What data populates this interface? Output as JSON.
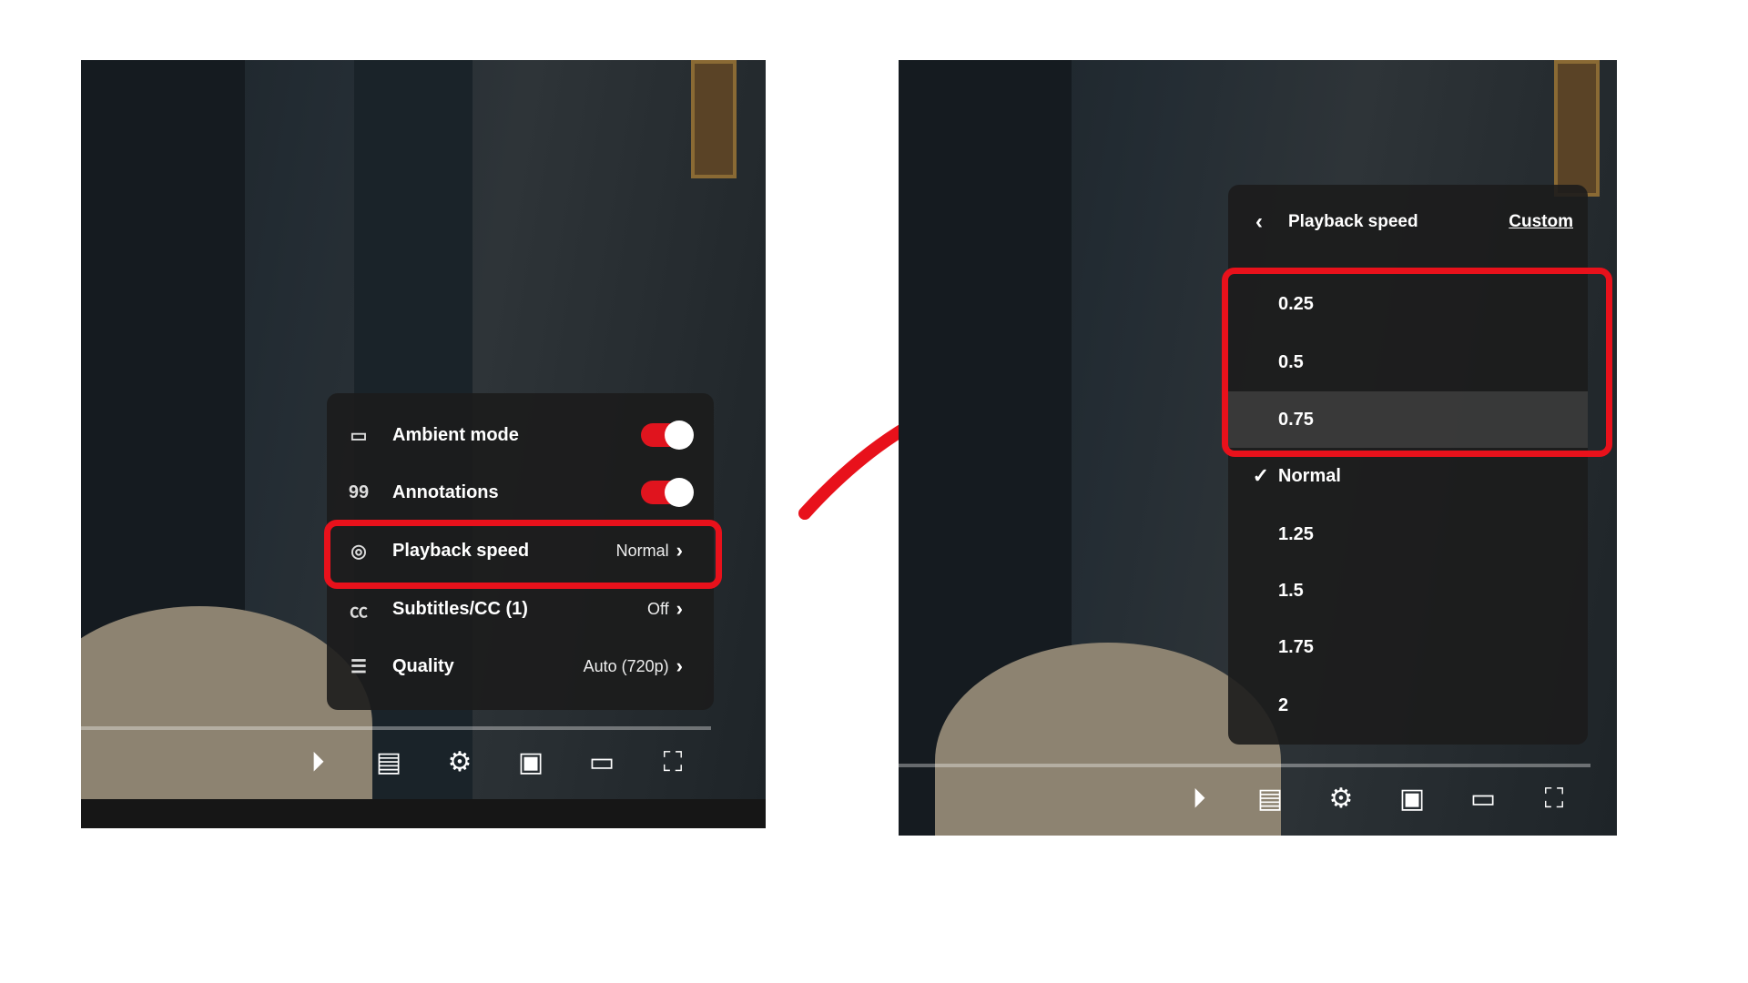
{
  "left_panel": {
    "menu": [
      {
        "icon": "ambient-mode-icon",
        "label": "Ambient mode",
        "toggle": true
      },
      {
        "icon": "annotations-icon",
        "label": "Annotations",
        "toggle": true
      },
      {
        "icon": "playback-speed-icon",
        "label": "Playback speed",
        "value": "Normal",
        "highlighted": true
      },
      {
        "icon": "subtitles-icon",
        "label": "Subtitles/CC (1)",
        "value": "Off"
      },
      {
        "icon": "quality-icon",
        "label": "Quality",
        "value": "Auto (720p)"
      }
    ]
  },
  "right_panel": {
    "header": {
      "title": "Playback speed",
      "custom": "Custom"
    },
    "options": [
      "0.25",
      "0.5",
      "0.75",
      "Normal",
      "1.25",
      "1.5",
      "1.75",
      "2"
    ],
    "selected": "Normal",
    "hovered": "0.75"
  },
  "controls": [
    "autoplay-toggle-icon",
    "subtitles-icon",
    "settings-gear-icon",
    "miniplayer-icon",
    "theater-mode-icon",
    "fullscreen-icon"
  ],
  "colors": {
    "highlight": "#e8111b",
    "toggle_on": "#e0141e",
    "menu_bg": "#1c1c1c"
  }
}
